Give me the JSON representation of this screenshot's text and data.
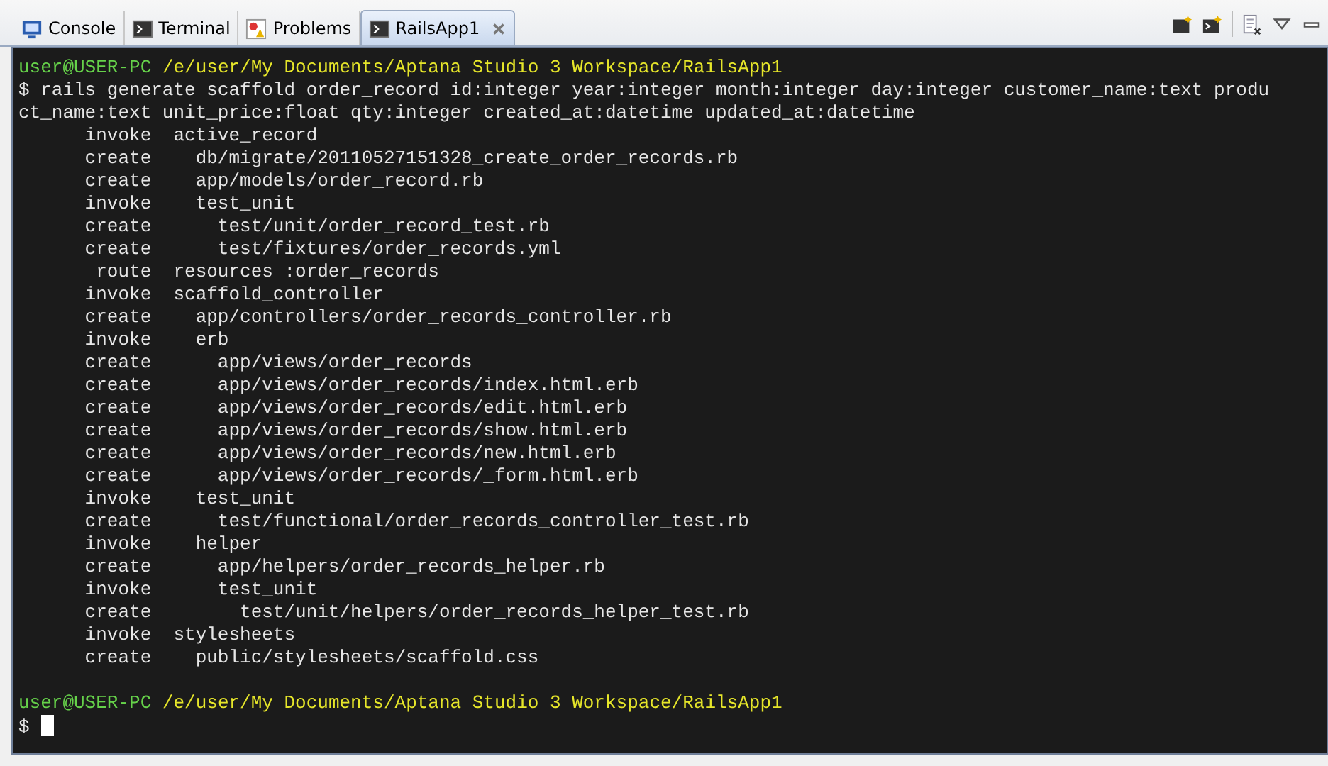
{
  "tabs": [
    {
      "label": "Console",
      "kind": "console",
      "selected": false,
      "closable": false
    },
    {
      "label": "Terminal",
      "kind": "terminal",
      "selected": false,
      "closable": false
    },
    {
      "label": "Problems",
      "kind": "problems",
      "selected": false,
      "closable": false
    },
    {
      "label": "RailsApp1",
      "kind": "terminal",
      "selected": true,
      "closable": true
    }
  ],
  "terminal": {
    "lines": [
      {
        "kind": "prompt",
        "user": "user@USER-PC",
        "path": "/e/user/My Documents/Aptana Studio 3 Workspace/RailsApp1"
      },
      {
        "kind": "text",
        "text": "$ rails generate scaffold order_record id:integer year:integer month:integer day:integer customer_name:text produ"
      },
      {
        "kind": "text",
        "text": "ct_name:text unit_price:float qty:integer created_at:datetime updated_at:datetime"
      },
      {
        "kind": "text",
        "text": "      invoke  active_record"
      },
      {
        "kind": "text",
        "text": "      create    db/migrate/20110527151328_create_order_records.rb"
      },
      {
        "kind": "text",
        "text": "      create    app/models/order_record.rb"
      },
      {
        "kind": "text",
        "text": "      invoke    test_unit"
      },
      {
        "kind": "text",
        "text": "      create      test/unit/order_record_test.rb"
      },
      {
        "kind": "text",
        "text": "      create      test/fixtures/order_records.yml"
      },
      {
        "kind": "text",
        "text": "       route  resources :order_records"
      },
      {
        "kind": "text",
        "text": "      invoke  scaffold_controller"
      },
      {
        "kind": "text",
        "text": "      create    app/controllers/order_records_controller.rb"
      },
      {
        "kind": "text",
        "text": "      invoke    erb"
      },
      {
        "kind": "text",
        "text": "      create      app/views/order_records"
      },
      {
        "kind": "text",
        "text": "      create      app/views/order_records/index.html.erb"
      },
      {
        "kind": "text",
        "text": "      create      app/views/order_records/edit.html.erb"
      },
      {
        "kind": "text",
        "text": "      create      app/views/order_records/show.html.erb"
      },
      {
        "kind": "text",
        "text": "      create      app/views/order_records/new.html.erb"
      },
      {
        "kind": "text",
        "text": "      create      app/views/order_records/_form.html.erb"
      },
      {
        "kind": "text",
        "text": "      invoke    test_unit"
      },
      {
        "kind": "text",
        "text": "      create      test/functional/order_records_controller_test.rb"
      },
      {
        "kind": "text",
        "text": "      invoke    helper"
      },
      {
        "kind": "text",
        "text": "      create      app/helpers/order_records_helper.rb"
      },
      {
        "kind": "text",
        "text": "      invoke      test_unit"
      },
      {
        "kind": "text",
        "text": "      create        test/unit/helpers/order_records_helper_test.rb"
      },
      {
        "kind": "text",
        "text": "      invoke  stylesheets"
      },
      {
        "kind": "text",
        "text": "      create    public/stylesheets/scaffold.css"
      },
      {
        "kind": "blank"
      },
      {
        "kind": "prompt",
        "user": "user@USER-PC",
        "path": "/e/user/My Documents/Aptana Studio 3 Workspace/RailsApp1"
      },
      {
        "kind": "input",
        "prompt": "$"
      }
    ]
  }
}
